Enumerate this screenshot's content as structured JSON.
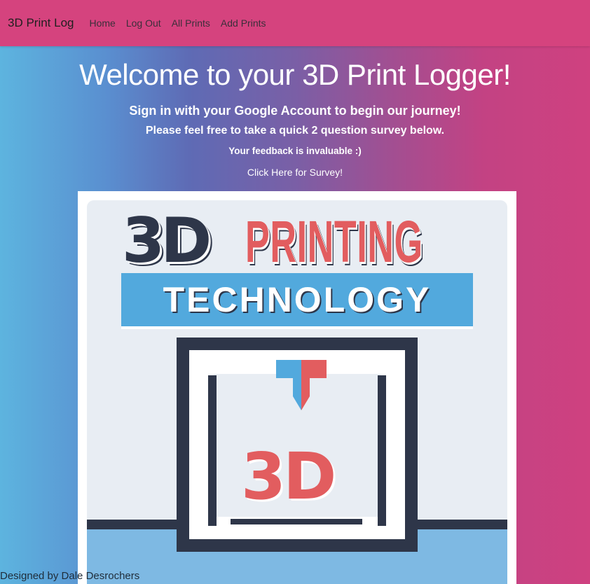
{
  "navbar": {
    "brand": "3D Print Log",
    "links": [
      "Home",
      "Log Out",
      "All Prints",
      "Add Prints"
    ],
    "color": "#d5437e"
  },
  "main": {
    "title": "Welcome to your 3D Print Logger!",
    "line1": "Sign in with your Google Account to begin our journey!",
    "line2": "Please feel free to take a quick 2 question survey below.",
    "line3": "Your feedback is invaluable :)",
    "survey_link": "Click Here for Survey!"
  },
  "hero_image": {
    "text_3d": "3D",
    "text_printing": "PRINTING",
    "text_technology": "TECHNOLOGY",
    "text_print": "3D"
  },
  "footer": {
    "credit": "Designed by Dale Desrochers"
  }
}
